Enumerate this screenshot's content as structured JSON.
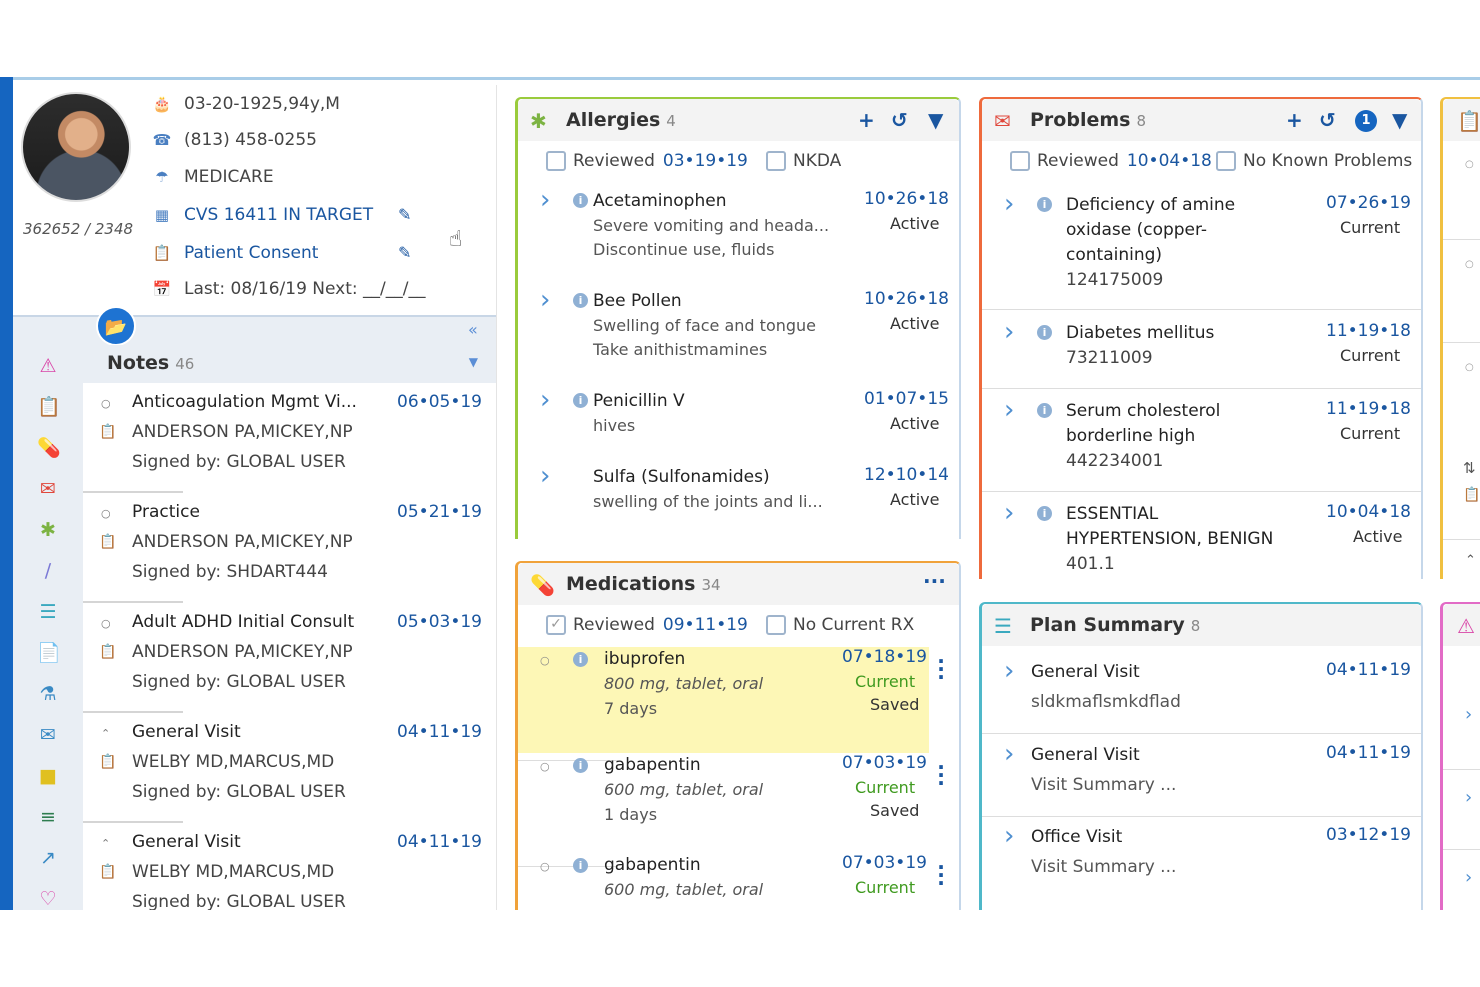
{
  "patient": {
    "dob_age_sex": "03-20-1925,94y,M",
    "phone": "(813) 458-0255",
    "insurance": "MEDICARE",
    "pharmacy": "CVS 16411 IN TARGET",
    "consent": "Patient Consent",
    "visits": "Last: 08/16/19 Next: __/__/__",
    "mrn": "362652 / 2348"
  },
  "notes": {
    "title": "Notes",
    "count": "46",
    "items": [
      {
        "title": "Anticoagulation Mgmt Vi...",
        "date": "06•05•19",
        "who": "ANDERSON PA,MICKEY,NP",
        "signed": "Signed by: GLOBAL USER",
        "bullet": "○"
      },
      {
        "title": "Practice",
        "date": "05•21•19",
        "who": "ANDERSON PA,MICKEY,NP",
        "signed": "Signed by: SHDART444",
        "bullet": "○"
      },
      {
        "title": "Adult ADHD Initial Consult",
        "date": "05•03•19",
        "who": "ANDERSON PA,MICKEY,NP",
        "signed": "Signed by: GLOBAL USER",
        "bullet": "○"
      },
      {
        "title": "General Visit",
        "date": "04•11•19",
        "who": "WELBY MD,MARCUS,MD",
        "signed": "Signed by: GLOBAL USER",
        "bullet": "⌃"
      },
      {
        "title": "General Visit",
        "date": "04•11•19",
        "who": "WELBY MD,MARCUS,MD",
        "signed": "Signed by: GLOBAL USER",
        "bullet": "⌃"
      }
    ]
  },
  "allergies": {
    "title": "Allergies",
    "count": "4",
    "reviewed_label": "Reviewed",
    "reviewed_date": "03•19•19",
    "nkda_label": "NKDA",
    "items": [
      {
        "name": "Acetaminophen",
        "line1": "Severe vomiting and heada...",
        "line2": "Discontinue use, fluids",
        "date": "10•26•18",
        "status": "Active"
      },
      {
        "name": "Bee Pollen",
        "line1": "Swelling of face and tongue",
        "line2": "Take anithistmamines",
        "date": "10•26•18",
        "status": "Active"
      },
      {
        "name": "Penicillin V",
        "line1": "hives",
        "line2": "",
        "date": "01•07•15",
        "status": "Active"
      },
      {
        "name": "Sulfa (Sulfonamides)",
        "line1": "swelling of the joints and li...",
        "line2": "",
        "date": "12•10•14",
        "status": "Active"
      }
    ]
  },
  "medications": {
    "title": "Medications",
    "count": "34",
    "reviewed_label": "Reviewed",
    "reviewed_date": "09•11•19",
    "norx_label": "No Current RX",
    "items": [
      {
        "name": "ibuprofen",
        "dose": "800 mg, tablet, oral",
        "days": "7 days",
        "date": "07•18•19",
        "status": "Current",
        "saved": "Saved"
      },
      {
        "name": "gabapentin",
        "dose": "600 mg, tablet, oral",
        "days": "1 days",
        "date": "07•03•19",
        "status": "Current",
        "saved": "Saved"
      },
      {
        "name": "gabapentin",
        "dose": "600 mg, tablet, oral",
        "days": "",
        "date": "07•03•19",
        "status": "Current",
        "saved": ""
      }
    ]
  },
  "problems": {
    "title": "Problems",
    "count": "8",
    "badge": "1",
    "reviewed_label": "Reviewed",
    "reviewed_date": "10•04•18",
    "nkp_label": "No Known Problems",
    "items": [
      {
        "lines": [
          "Deficiency of amine",
          "oxidase (copper-",
          "containing)",
          "124175009"
        ],
        "date": "07•26•19",
        "status": "Current"
      },
      {
        "lines": [
          "Diabetes mellitus",
          "73211009"
        ],
        "date": "11•19•18",
        "status": "Current"
      },
      {
        "lines": [
          "Serum cholesterol",
          "borderline high",
          "442234001"
        ],
        "date": "11•19•18",
        "status": "Current"
      },
      {
        "lines": [
          "ESSENTIAL",
          "HYPERTENSION, BENIGN",
          "401.1"
        ],
        "date": "10•04•18",
        "status": "Active"
      }
    ]
  },
  "plan_summary": {
    "title": "Plan Summary",
    "count": "8",
    "items": [
      {
        "name": "General Visit",
        "sub": "sldkmaflsmkdflad",
        "date": "04•11•19"
      },
      {
        "name": "General Visit",
        "sub": "Visit Summary  ...",
        "date": "04•11•19"
      },
      {
        "name": "Office Visit",
        "sub": "Visit Summary  ...",
        "date": "03•12•19"
      }
    ]
  },
  "colors": {
    "allergies": "#9acb3c",
    "medications": "#f0a23a",
    "problems": "#ee6a3c",
    "plan": "#4fb8c9",
    "right1": "#f0c040",
    "right2": "#e26bc6",
    "link": "#1a56a0",
    "highlight": "#fdf7b6"
  },
  "icons": [
    "cake-icon",
    "phone-icon",
    "umbrella-icon",
    "pharmacy-icon",
    "clipboard-icon",
    "calendar-icon",
    "pencil-icon",
    "folder-icon",
    "collapse-icon"
  ]
}
